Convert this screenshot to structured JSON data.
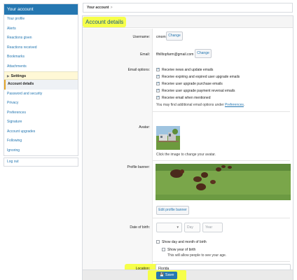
{
  "sidebar": {
    "header": "Your account",
    "items_top": [
      "Your profile",
      "Alerts",
      "Reactions given",
      "Reactions received",
      "Bookmarks",
      "Attachments"
    ],
    "settings_group": "Settings",
    "items_settings": [
      "Account details",
      "Password and security",
      "Privacy",
      "Preferences",
      "Signature",
      "Account upgrades",
      "Following",
      "Ignoring"
    ],
    "logout": "Log out"
  },
  "breadcrumb": {
    "label": "Your account",
    "sep": ">"
  },
  "panel": {
    "title": "Account details"
  },
  "form": {
    "username": {
      "label": "Username:",
      "value": "cmom",
      "button": "Change"
    },
    "email": {
      "label": "Email:",
      "value": "flhilltopfarm@gmail.com",
      "button": "Change"
    },
    "email_options": {
      "label": "Email options:",
      "options": [
        "Receive news and update emails",
        "Receive expiring and expired user upgrade emails",
        "Receive user upgrade purchase emails",
        "Receive user upgrade payment reversal emails",
        "Receive email when mentioned"
      ],
      "hint_prefix": "You may find additional email options under",
      "hint_link": "Preferences",
      "hint_suffix": "."
    },
    "avatar": {
      "label": "Avatar:",
      "hint": "Click the image to change your avatar."
    },
    "banner": {
      "label": "Profile banner:",
      "button": "Edit profile banner"
    },
    "dob": {
      "label": "Date of birth:",
      "month_placeholder": "",
      "day_placeholder": "Day",
      "year_placeholder": "Year",
      "show_day_month": "Show day and month of birth",
      "show_year": "Show year of birth",
      "show_year_hint": "This will allow people to see your age."
    },
    "location": {
      "label": "Location:",
      "value": "Florida"
    },
    "save": "Save"
  },
  "colors": {
    "accent": "#2577b1",
    "highlight": "#f6ff4a"
  }
}
